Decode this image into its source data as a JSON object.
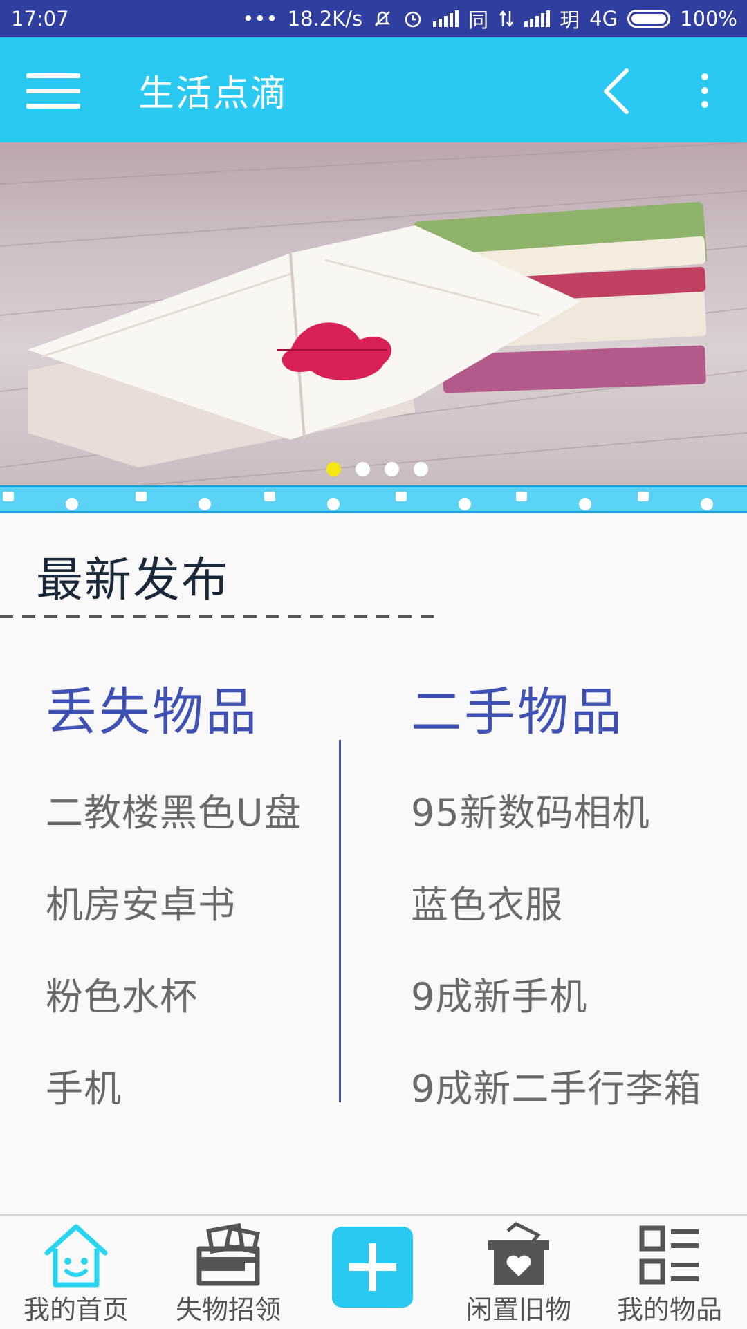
{
  "status_bar": {
    "time": "17:07",
    "dots": "•••",
    "speed": "18.2K/s",
    "carrier1": "同",
    "carrier2": "玥",
    "network": "4G",
    "battery": "100%",
    "battery_level": 1.0
  },
  "app_bar": {
    "title": "生活点滴",
    "menu_icon": "hamburger-menu-icon",
    "back_icon": "chevron-left-icon",
    "more_icon": "more-vertical-icon"
  },
  "banner": {
    "slides": 4,
    "active_slide": 1
  },
  "latest": {
    "title": "最新发布",
    "lost": {
      "header": "丢失物品",
      "items": [
        "二教楼黑色U盘",
        "机房安卓书",
        "粉色水杯",
        "手机"
      ]
    },
    "second_hand": {
      "header": "二手物品",
      "items": [
        "95新数码相机",
        "蓝色衣服",
        "9成新手机",
        "9成新二手行李箱"
      ]
    }
  },
  "bottom_nav": {
    "tabs": [
      {
        "label": "我的首页",
        "icon": "home-smile-icon",
        "active": true
      },
      {
        "label": "失物招领",
        "icon": "wallet-icon"
      },
      {
        "label": "",
        "icon": "plus-icon"
      },
      {
        "label": "闲置旧物",
        "icon": "heart-box-icon"
      },
      {
        "label": "我的物品",
        "icon": "list-icon"
      }
    ]
  },
  "colors": {
    "status_bar": "#303f9f",
    "app_bar": "#29c9f2",
    "accent": "#3f51b5",
    "active_dot": "#f5e512"
  }
}
